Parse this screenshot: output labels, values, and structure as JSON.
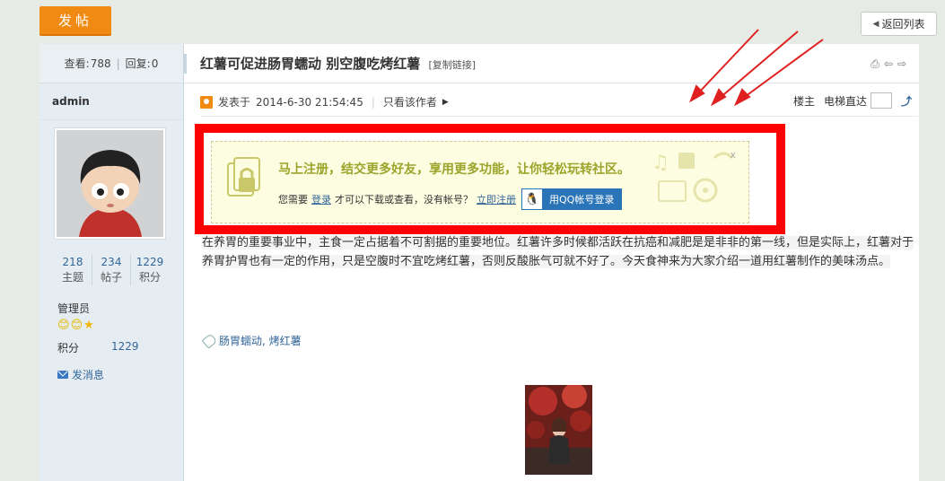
{
  "toolbar": {
    "post_label": "发帖",
    "back_label": "返回列表"
  },
  "sidebar": {
    "views_label": "查看:",
    "views": "788",
    "replies_label": "回复:",
    "replies": "0",
    "author": "admin",
    "counts": [
      {
        "num": "218",
        "label": "主题"
      },
      {
        "num": "234",
        "label": "帖子"
      },
      {
        "num": "1229",
        "label": "积分"
      }
    ],
    "role": "管理员",
    "points_label": "积分",
    "points": "1229",
    "message_label": "发消息"
  },
  "post": {
    "title": "红薯可促进肠胃蠕动 别空腹吃烤红薯",
    "copy_link": "[复制链接]",
    "posted_prefix": "发表于",
    "posted_at": "2014-6-30 21:54:45",
    "only_author": "只看该作者",
    "floor_label": "楼主",
    "jump_label": "电梯直达",
    "tags_label": "肠胃蠕动, 烤红薯",
    "body": "在养胃的重要事业中，主食一定占据着不可割据的重要地位。红薯许多时候都活跃在抗癌和减肥是是非非的第一线，但是实际上，红薯对于养胃护胃也有一定的作用，只是空腹时不宜吃烤红薯，否则反酸胀气可就不好了。今天食神来为大家介绍一道用红薯制作的美味汤点。"
  },
  "notice": {
    "headline": "马上注册，结交更多好友，享用更多功能，让你轻松玩转社区。",
    "prefix": "您需要",
    "login_link": "登录",
    "middle": "才可以下载或查看，没有帐号？",
    "register_link": "立即注册",
    "qq_label": "用QQ帐号登录",
    "close": "x"
  },
  "colors": {
    "accent": "#f08a12",
    "highlight": "#ff0000",
    "link": "#336699"
  }
}
